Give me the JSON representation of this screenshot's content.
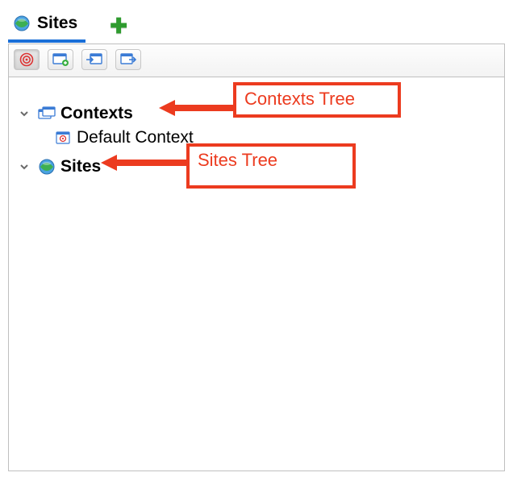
{
  "tabs": {
    "sites_label": "Sites"
  },
  "tree": {
    "contexts_label": "Contexts",
    "default_context_label": "Default Context",
    "sites_label": "Sites"
  },
  "annotations": {
    "contexts_note": "Contexts Tree",
    "sites_note": "Sites Tree"
  }
}
